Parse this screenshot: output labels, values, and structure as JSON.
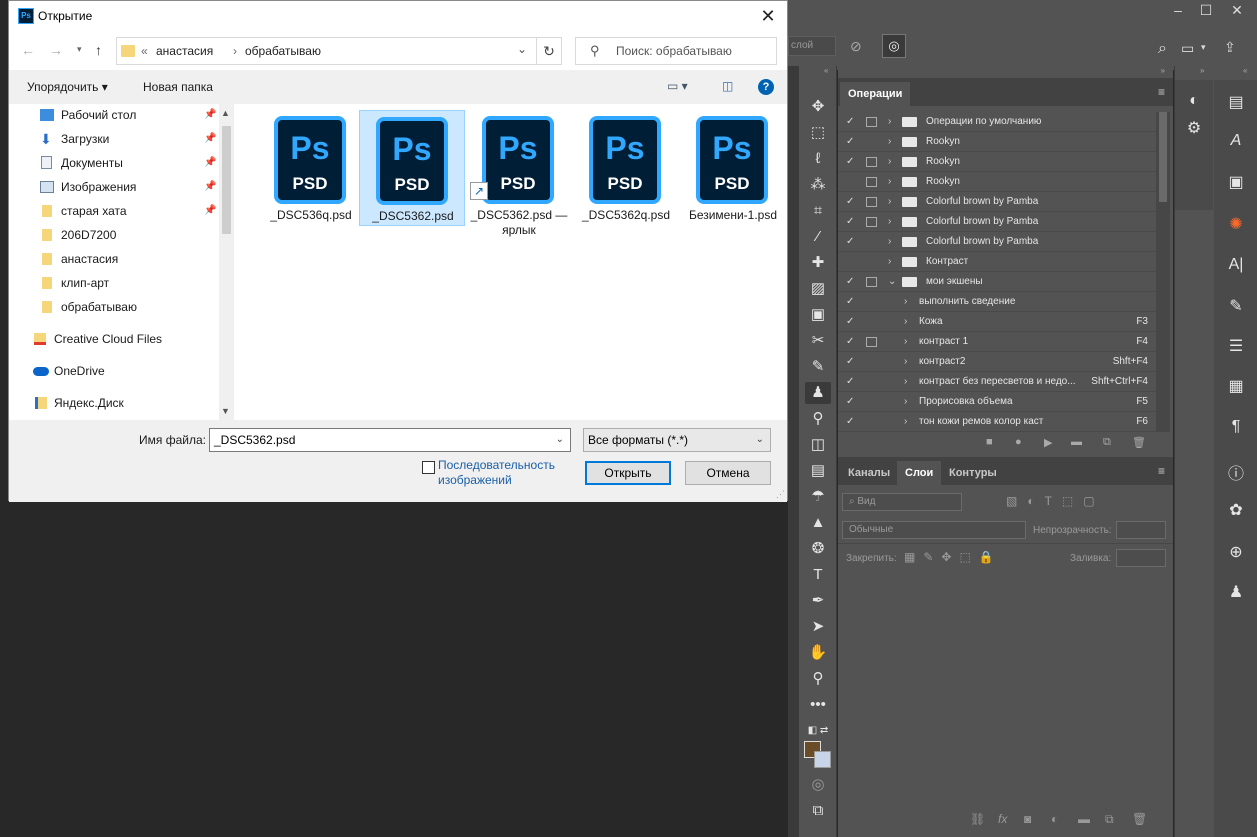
{
  "dialog": {
    "title": "Открытие",
    "address": {
      "crumb_sep": "«",
      "part1": "анастасия",
      "arrow": "›",
      "part2": "обрабатываю"
    },
    "search_placeholder": "Поиск: обрабатываю",
    "cmd": {
      "organize": "Упорядочить",
      "new_folder": "Новая папка"
    },
    "nav": [
      {
        "label": "Рабочий стол",
        "pinned": true
      },
      {
        "label": "Загрузки",
        "pinned": true
      },
      {
        "label": "Документы",
        "pinned": true
      },
      {
        "label": "Изображения",
        "pinned": true
      },
      {
        "label": "старая хата",
        "pinned": true
      },
      {
        "label": "206D7200",
        "pinned": false
      },
      {
        "label": "анастасия",
        "pinned": false
      },
      {
        "label": "клип-арт",
        "pinned": false
      },
      {
        "label": "обрабатываю",
        "pinned": false
      },
      {
        "label": "Creative Cloud Files",
        "pinned": false
      },
      {
        "label": "OneDrive",
        "pinned": false
      },
      {
        "label": "Яндекс.Диск",
        "pinned": false
      }
    ],
    "files": [
      {
        "name": "_DSC536q.psd",
        "icon_big": "Ps",
        "icon_small": "PSD"
      },
      {
        "name": "_DSC5362.psd",
        "icon_big": "Ps",
        "icon_small": "PSD"
      },
      {
        "name": "_DSC5362.psd — ярлык",
        "icon_big": "Ps",
        "icon_small": "PSD"
      },
      {
        "name": "_DSC5362q.psd",
        "icon_big": "Ps",
        "icon_small": "PSD"
      },
      {
        "name": "Безимени-1.psd",
        "icon_big": "Ps",
        "icon_small": "PSD"
      }
    ],
    "filename_label": "Имя файла:",
    "filename_value": "_DSC5362.psd",
    "filter_value": "Все форматы (*.*)",
    "sequence_label": "Последовательность изображений",
    "open_button": "Открыть",
    "cancel_button": "Отмена"
  },
  "ps": {
    "options_text": "слой",
    "actions_tab": "Операции",
    "actions": [
      {
        "checked": true,
        "dialog": true,
        "level": 0,
        "folder": true,
        "label": "Операции по умолчанию",
        "key": ""
      },
      {
        "checked": true,
        "dialog": false,
        "level": 0,
        "folder": true,
        "label": "Rookyn",
        "key": ""
      },
      {
        "checked": true,
        "dialog": true,
        "level": 0,
        "folder": true,
        "label": "Rookyn",
        "key": ""
      },
      {
        "checked": false,
        "dialog": true,
        "level": 0,
        "folder": true,
        "label": "Rookyn",
        "key": ""
      },
      {
        "checked": true,
        "dialog": true,
        "level": 0,
        "folder": true,
        "label": "Colorful brown by Pamba",
        "key": ""
      },
      {
        "checked": true,
        "dialog": true,
        "level": 0,
        "folder": true,
        "label": "Colorful brown by Pamba",
        "key": ""
      },
      {
        "checked": true,
        "dialog": false,
        "level": 0,
        "folder": true,
        "label": "Colorful brown by Pamba",
        "key": ""
      },
      {
        "checked": false,
        "dialog": false,
        "level": 0,
        "folder": true,
        "label": "Контраст",
        "key": ""
      },
      {
        "checked": true,
        "dialog": true,
        "level": 0,
        "folder": true,
        "open": true,
        "label": "мои экшены",
        "key": ""
      },
      {
        "checked": true,
        "dialog": false,
        "level": 1,
        "folder": false,
        "label": "выполнить сведение",
        "key": ""
      },
      {
        "checked": true,
        "dialog": false,
        "level": 1,
        "folder": false,
        "label": "Кожа",
        "key": "F3"
      },
      {
        "checked": true,
        "dialog": true,
        "level": 1,
        "folder": false,
        "label": "контраст 1",
        "key": "F4"
      },
      {
        "checked": true,
        "dialog": false,
        "level": 1,
        "folder": false,
        "label": "контраст2",
        "key": "Shft+F4"
      },
      {
        "checked": true,
        "dialog": false,
        "level": 1,
        "folder": false,
        "label": "контраст без пересветов и недо...",
        "key": "Shft+Ctrl+F4"
      },
      {
        "checked": true,
        "dialog": false,
        "level": 1,
        "folder": false,
        "label": "Прорисовка объема",
        "key": "F5"
      },
      {
        "checked": true,
        "dialog": false,
        "level": 1,
        "folder": false,
        "label": "тон кожи ремов колор каст",
        "key": "F6"
      }
    ],
    "layers_tabs": [
      "Каналы",
      "Слои",
      "Контуры"
    ],
    "layers_active": "Слои",
    "layers_search": "Вид",
    "blend_mode": "Обычные",
    "opacity_label": "Непрозрачность:",
    "lock_label": "Закрепить:",
    "fill_label": "Заливка:",
    "fg_color": "#6b4c28",
    "bg_color": "#c8d4e8"
  }
}
